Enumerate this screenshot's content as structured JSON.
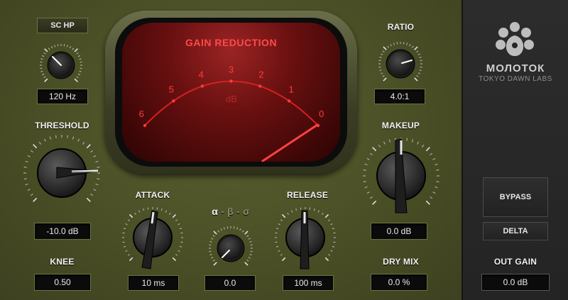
{
  "sc_hp": {
    "button_label": "SC HP",
    "value": "120 Hz"
  },
  "ratio": {
    "label": "RATIO",
    "value": "4.0:1"
  },
  "threshold": {
    "label": "THRESHOLD",
    "value": "-10.0 dB"
  },
  "makeup": {
    "label": "MAKEUP",
    "value": "0.0 dB"
  },
  "attack": {
    "label": "ATTACK",
    "value": "10 ms"
  },
  "release": {
    "label": "RELEASE",
    "value": "100 ms"
  },
  "abs": {
    "alpha": "α",
    "sep1": " - ",
    "beta": "β",
    "sep2": " - ",
    "sigma": "σ",
    "value": "0.0"
  },
  "knee": {
    "label": "KNEE",
    "value": "0.50"
  },
  "drymix": {
    "label": "DRY MIX",
    "value": "0.0 %"
  },
  "meter": {
    "title": "GAIN REDUCTION",
    "unit": "dB",
    "scale": [
      "6",
      "5",
      "4",
      "3",
      "2",
      "1",
      "0"
    ],
    "needle_db": 0.2
  },
  "brand": {
    "name": "МОЛОТОК",
    "maker": "TOKYO DAWN LABS"
  },
  "side": {
    "bypass_label": "BYPASS",
    "delta_label": "DELTA",
    "out_gain_label": "OUT GAIN",
    "out_gain_value": "0.0 dB"
  },
  "colors": {
    "panel": "#4a4f26",
    "meter_red": "#ff3b3b",
    "side_panel": "#262626"
  }
}
